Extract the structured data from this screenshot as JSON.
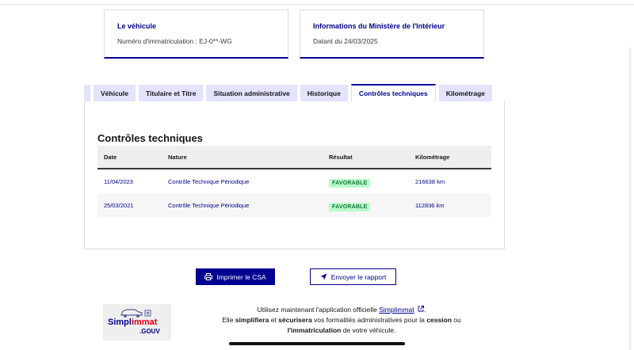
{
  "cards": {
    "vehicle": {
      "title": "Le véhicule",
      "subtitle": "Numéro d'immatriculation : EJ-0**-WG"
    },
    "ministry": {
      "title": "Informations du Ministère de l'Intérieur",
      "subtitle": "Datant du 24/03/2025"
    }
  },
  "tabs": [
    {
      "label": "Véhicule",
      "active": false
    },
    {
      "label": "Titulaire et Titre",
      "active": false
    },
    {
      "label": "Situation administrative",
      "active": false
    },
    {
      "label": "Historique",
      "active": false
    },
    {
      "label": "Contrôles techniques",
      "active": true
    },
    {
      "label": "Kilométrage",
      "active": false
    }
  ],
  "section": {
    "title": "Contrôles techniques"
  },
  "table": {
    "headers": [
      "Date",
      "Nature",
      "Résultat",
      "Kilométrage"
    ],
    "rows": [
      {
        "date": "11/04/2023",
        "nature": "Contrôle Technique Périodique",
        "result": "FAVORABLE",
        "mileage": "216638 km"
      },
      {
        "date": "25/03/2021",
        "nature": "Contrôle Technique Périodique",
        "result": "FAVORABLE",
        "mileage": "112836 km"
      }
    ]
  },
  "actions": {
    "print_label": "Imprimer le CSA",
    "send_label": "Envoyer le rapport"
  },
  "promo": {
    "logo_word_1": "Simpl",
    "logo_word_2": "immat",
    "logo_suffix": ".GOUV",
    "line1_prefix": "Utilisez maintenant l'application officielle ",
    "link": "Simplimmat",
    "line1_suffix": ".",
    "line2_a": "Elle ",
    "line2_b": "simplifiera",
    "line2_c": " et ",
    "line2_d": "sécurisera",
    "line2_e": " vos formalités administratives pour la ",
    "line2_f": "cession",
    "line2_g": " ou",
    "line3_a": "l'immatriculation",
    "line3_b": " de votre véhicule."
  },
  "colors": {
    "primary": "#000091",
    "tab_bg": "#e3e3fd",
    "badge_bg": "#b8fec9",
    "badge_text": "#18753c"
  },
  "icons": {
    "print": "printer-icon",
    "send": "send-icon",
    "external": "external-link-icon"
  }
}
